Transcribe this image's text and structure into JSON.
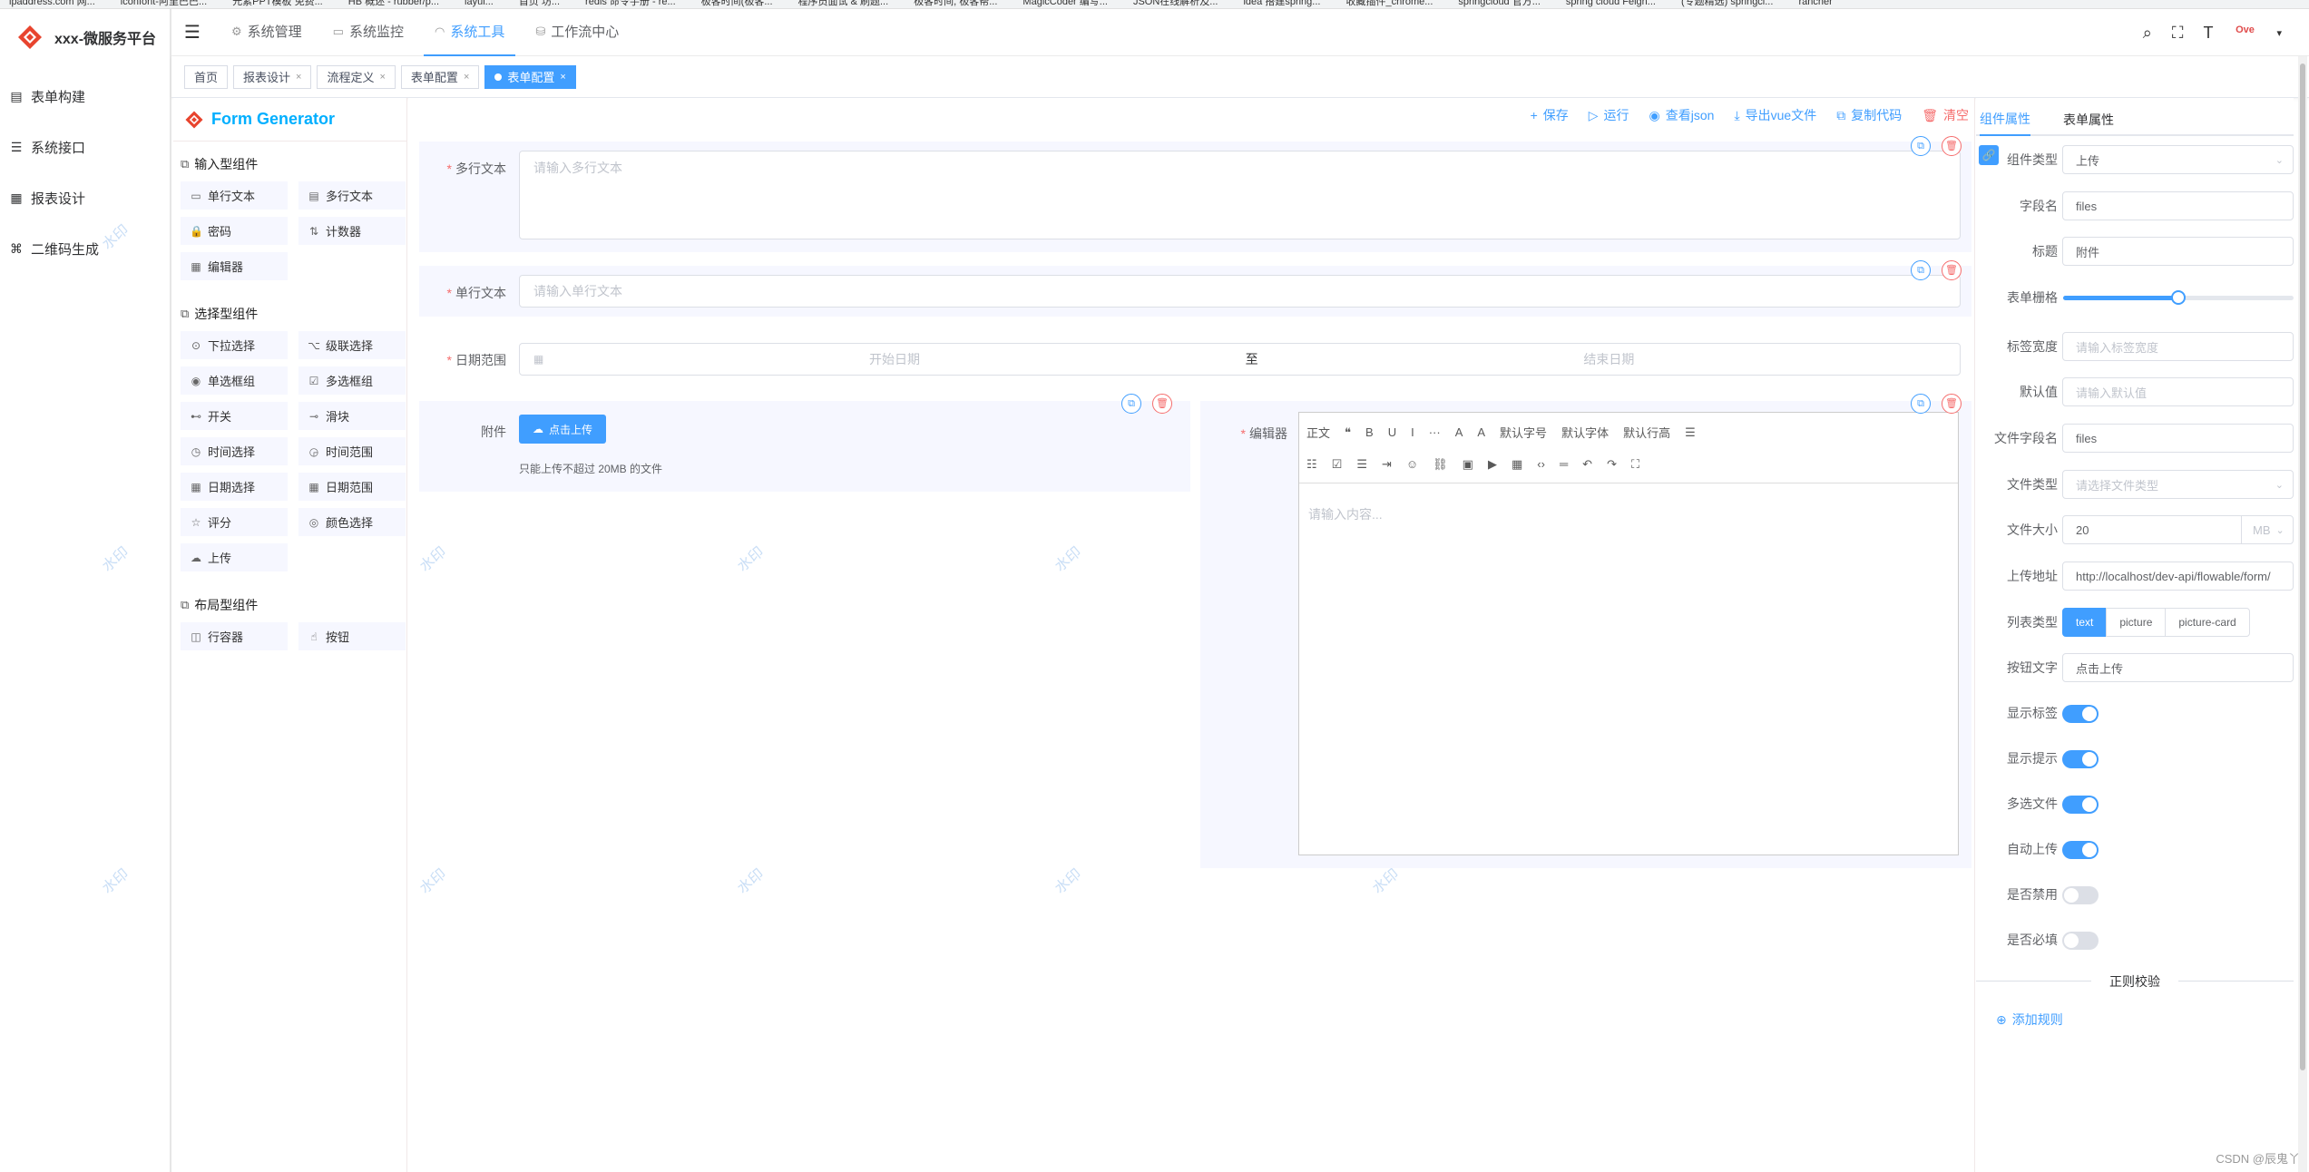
{
  "bookmarks": [
    "ipaddress.com 网...",
    "iconfont-阿里巴巴...",
    "元素PPT模板 免费...",
    "HB 概述 - rubber/p...",
    "layui...",
    "首页 坊...",
    "redis 命令手册 - re...",
    "极客时间(极客...",
    "程序员面试 & 刷题...",
    "极客时间, 极客帮...",
    "MagicCoder 编写...",
    "JSON在线解析及...",
    "idea 搭建spring...",
    "收藏插件_chrome...",
    "springcloud 官方...",
    "spring cloud Feign...",
    "(专题精选) springcl...",
    "rancher"
  ],
  "sidebar": {
    "title": "xxx-微服务平台",
    "items": [
      {
        "label": "表单构建",
        "icon": "form-icon"
      },
      {
        "label": "系统接口",
        "icon": "sliders-icon"
      },
      {
        "label": "报表设计",
        "icon": "table-icon"
      },
      {
        "label": "二维码生成",
        "icon": "qrcode-icon"
      }
    ]
  },
  "navbar": {
    "tabs": [
      {
        "label": "系统管理",
        "icon": "gear-icon",
        "active": false
      },
      {
        "label": "系统监控",
        "icon": "monitor-icon",
        "active": false
      },
      {
        "label": "系统工具",
        "icon": "tool-icon",
        "active": true
      },
      {
        "label": "工作流中心",
        "icon": "workflow-icon",
        "active": false
      }
    ],
    "avatar_text": "Ove"
  },
  "tagsview": [
    {
      "label": "首页",
      "closable": false,
      "active": false
    },
    {
      "label": "报表设计",
      "closable": true,
      "active": false
    },
    {
      "label": "流程定义",
      "closable": true,
      "active": false
    },
    {
      "label": "表单配置",
      "closable": true,
      "active": false
    },
    {
      "label": "表单配置",
      "closable": true,
      "active": true
    }
  ],
  "generator": {
    "title": "Form Generator",
    "groups": [
      {
        "title": "输入型组件",
        "items": [
          {
            "label": "单行文本",
            "icon": "▭"
          },
          {
            "label": "多行文本",
            "icon": "▤"
          },
          {
            "label": "密码",
            "icon": "🔒"
          },
          {
            "label": "计数器",
            "icon": "⇅"
          },
          {
            "label": "编辑器",
            "icon": "▦"
          }
        ]
      },
      {
        "title": "选择型组件",
        "items": [
          {
            "label": "下拉选择",
            "icon": "⊙"
          },
          {
            "label": "级联选择",
            "icon": "⌥"
          },
          {
            "label": "单选框组",
            "icon": "◉"
          },
          {
            "label": "多选框组",
            "icon": "☑"
          },
          {
            "label": "开关",
            "icon": "⊷"
          },
          {
            "label": "滑块",
            "icon": "⊸"
          },
          {
            "label": "时间选择",
            "icon": "◷"
          },
          {
            "label": "时间范围",
            "icon": "◶"
          },
          {
            "label": "日期选择",
            "icon": "▦"
          },
          {
            "label": "日期范围",
            "icon": "▦"
          },
          {
            "label": "评分",
            "icon": "☆"
          },
          {
            "label": "颜色选择",
            "icon": "◎"
          },
          {
            "label": "上传",
            "icon": "☁"
          }
        ]
      },
      {
        "title": "布局型组件",
        "items": [
          {
            "label": "行容器",
            "icon": "◫"
          },
          {
            "label": "按钮",
            "icon": "☝"
          }
        ]
      }
    ]
  },
  "actions": [
    {
      "label": "保存",
      "icon": "+",
      "danger": false
    },
    {
      "label": "运行",
      "icon": "▷",
      "danger": false
    },
    {
      "label": "查看json",
      "icon": "◉",
      "danger": false
    },
    {
      "label": "导出vue文件",
      "icon": "⤓",
      "danger": false
    },
    {
      "label": "复制代码",
      "icon": "⧉",
      "danger": false
    },
    {
      "label": "清空",
      "icon": "🗑",
      "danger": true
    }
  ],
  "canvas": {
    "textarea": {
      "label": "多行文本",
      "placeholder": "请输入多行文本"
    },
    "input": {
      "label": "单行文本",
      "placeholder": "请输入单行文本"
    },
    "daterange": {
      "label": "日期范围",
      "start": "开始日期",
      "sep": "至",
      "end": "结束日期"
    },
    "upload": {
      "label": "附件",
      "button": "点击上传",
      "tip": "只能上传不超过 20MB 的文件"
    },
    "editor": {
      "label": "编辑器",
      "toolbar_row1": [
        "正文",
        "❝",
        "B",
        "U",
        "I",
        "···",
        "A",
        "A",
        "默认字号",
        "默认字体",
        "默认行高",
        "☰"
      ],
      "toolbar_row2": [
        "☷",
        "☑",
        "☰",
        "⇥",
        "☺",
        "⛓",
        "▣",
        "▶",
        "▦",
        "‹›",
        "═",
        "↶",
        "↷",
        "⛶"
      ],
      "placeholder": "请输入内容..."
    },
    "watermark": "水印"
  },
  "props": {
    "tabs": [
      "组件属性",
      "表单属性"
    ],
    "component_type": {
      "label": "组件类型",
      "value": "上传"
    },
    "field_name": {
      "label": "字段名",
      "value": "files"
    },
    "title": {
      "label": "标题",
      "value": "附件"
    },
    "grid": {
      "label": "表单栅格",
      "value": 0.5
    },
    "label_width": {
      "label": "标签宽度",
      "placeholder": "请输入标签宽度"
    },
    "default_value": {
      "label": "默认值",
      "placeholder": "请输入默认值"
    },
    "file_field": {
      "label": "文件字段名",
      "value": "files"
    },
    "file_type": {
      "label": "文件类型",
      "placeholder": "请选择文件类型"
    },
    "file_size": {
      "label": "文件大小",
      "value": "20",
      "unit": "MB"
    },
    "upload_url": {
      "label": "上传地址",
      "value": "http://localhost/dev-api/flowable/form/"
    },
    "list_type": {
      "label": "列表类型",
      "options": [
        "text",
        "picture",
        "picture-card"
      ],
      "selected": "text"
    },
    "button_text": {
      "label": "按钮文字",
      "value": "点击上传"
    },
    "switches": [
      {
        "label": "显示标签",
        "on": true
      },
      {
        "label": "显示提示",
        "on": true
      },
      {
        "label": "多选文件",
        "on": true
      },
      {
        "label": "自动上传",
        "on": true
      },
      {
        "label": "是否禁用",
        "on": false
      },
      {
        "label": "是否必填",
        "on": false
      }
    ],
    "regex_title": "正则校验",
    "add_rule": "添加规则"
  },
  "footer": "CSDN @辰鬼丫"
}
